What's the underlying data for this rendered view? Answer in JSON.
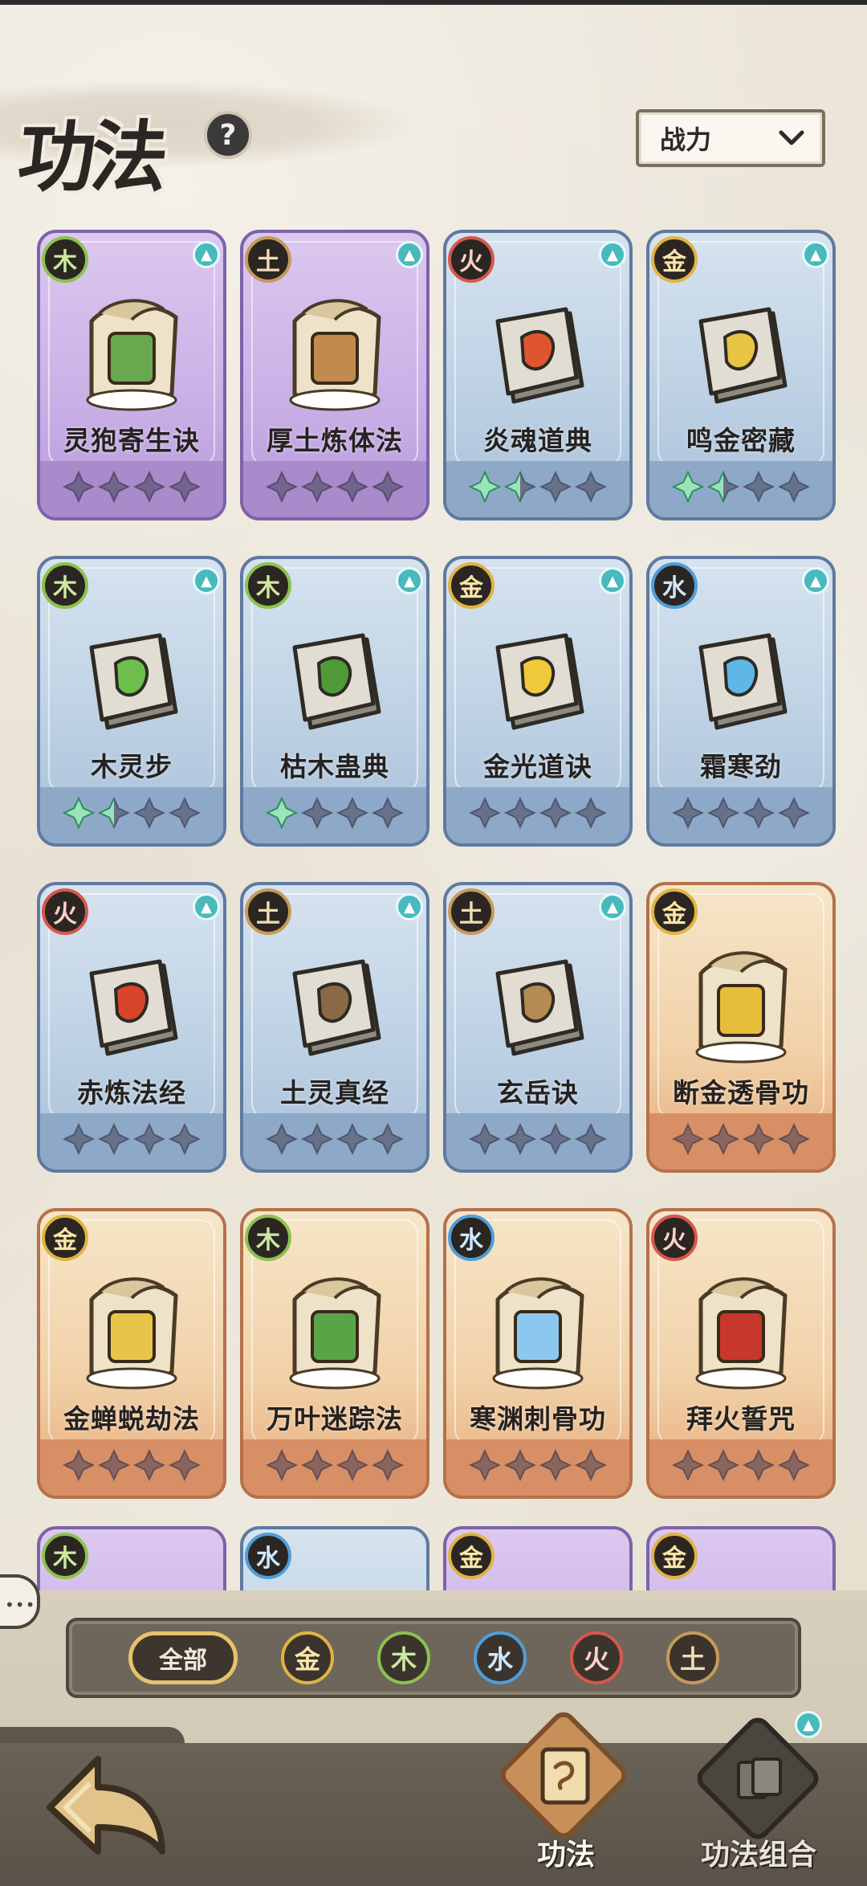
{
  "header": {
    "title": "功法",
    "help_label": "?",
    "sort": {
      "selected": "战力"
    }
  },
  "cards": [
    {
      "name": "灵狍寄生诀",
      "element": "木",
      "element_key": "wood",
      "rarity": "purple",
      "art": "scroll",
      "accent": "#6aa84f",
      "stars_filled": 0
    },
    {
      "name": "厚土炼体法",
      "element": "土",
      "element_key": "earth",
      "rarity": "purple",
      "art": "scroll",
      "accent": "#c18a4e",
      "stars_filled": 0
    },
    {
      "name": "炎魂道典",
      "element": "火",
      "element_key": "fire",
      "rarity": "blue",
      "art": "book",
      "accent": "#e0552f",
      "stars_filled": 1.5
    },
    {
      "name": "鸣金密藏",
      "element": "金",
      "element_key": "metal",
      "rarity": "blue",
      "art": "book",
      "accent": "#e7c443",
      "stars_filled": 1.5
    },
    {
      "name": "木灵步",
      "element": "木",
      "element_key": "wood",
      "rarity": "blue",
      "art": "book",
      "accent": "#6bbf4a",
      "stars_filled": 1.5
    },
    {
      "name": "枯木蛊典",
      "element": "木",
      "element_key": "wood",
      "rarity": "blue",
      "art": "book",
      "accent": "#4f9b37",
      "stars_filled": 1
    },
    {
      "name": "金光道诀",
      "element": "金",
      "element_key": "metal",
      "rarity": "blue",
      "art": "book",
      "accent": "#f0c93a",
      "stars_filled": 0
    },
    {
      "name": "霜寒劲",
      "element": "水",
      "element_key": "water",
      "rarity": "blue",
      "art": "book",
      "accent": "#5fb7e6",
      "stars_filled": 0
    },
    {
      "name": "赤炼法经",
      "element": "火",
      "element_key": "fire",
      "rarity": "blue",
      "art": "book",
      "accent": "#d8452b",
      "stars_filled": 0
    },
    {
      "name": "土灵真经",
      "element": "土",
      "element_key": "earth",
      "rarity": "blue",
      "art": "book",
      "accent": "#8a6a46",
      "stars_filled": 0
    },
    {
      "name": "玄岳诀",
      "element": "土",
      "element_key": "earth",
      "rarity": "blue",
      "art": "book",
      "accent": "#b58b53",
      "stars_filled": 0
    },
    {
      "name": "断金透骨功",
      "element": "金",
      "element_key": "metal",
      "rarity": "orange",
      "art": "scroll",
      "accent": "#e6be3c",
      "stars_filled": 0
    },
    {
      "name": "金蝉蜕劫法",
      "element": "金",
      "element_key": "metal",
      "rarity": "orange",
      "art": "scroll",
      "accent": "#e8c54a",
      "stars_filled": 0
    },
    {
      "name": "万叶迷踪法",
      "element": "木",
      "element_key": "wood",
      "rarity": "orange",
      "art": "scroll",
      "accent": "#5aa447",
      "stars_filled": 0
    },
    {
      "name": "寒渊刺骨功",
      "element": "水",
      "element_key": "water",
      "rarity": "orange",
      "art": "scroll",
      "accent": "#8cc8ee",
      "stars_filled": 0
    },
    {
      "name": "拜火誓咒",
      "element": "火",
      "element_key": "fire",
      "rarity": "orange",
      "art": "scroll",
      "accent": "#c8372b",
      "stars_filled": 0
    }
  ],
  "partial_cards": [
    {
      "element": "木",
      "element_key": "wood",
      "rarity": "purple"
    },
    {
      "element": "水",
      "element_key": "water",
      "rarity": "blue"
    },
    {
      "element": "金",
      "element_key": "metal",
      "rarity": "purple"
    },
    {
      "element": "金",
      "element_key": "metal",
      "rarity": "purple"
    }
  ],
  "filters": {
    "all_label": "全部",
    "elements": [
      {
        "label": "金",
        "key": "metal"
      },
      {
        "label": "木",
        "key": "wood"
      },
      {
        "label": "水",
        "key": "water"
      },
      {
        "label": "火",
        "key": "fire"
      },
      {
        "label": "土",
        "key": "earth"
      }
    ]
  },
  "nav": {
    "tab_gongfa": "功法",
    "tab_combo": "功法组合"
  },
  "icons": {
    "upgrade": "arrow-up-icon",
    "star": "star-icon",
    "back": "back-arrow-icon"
  }
}
